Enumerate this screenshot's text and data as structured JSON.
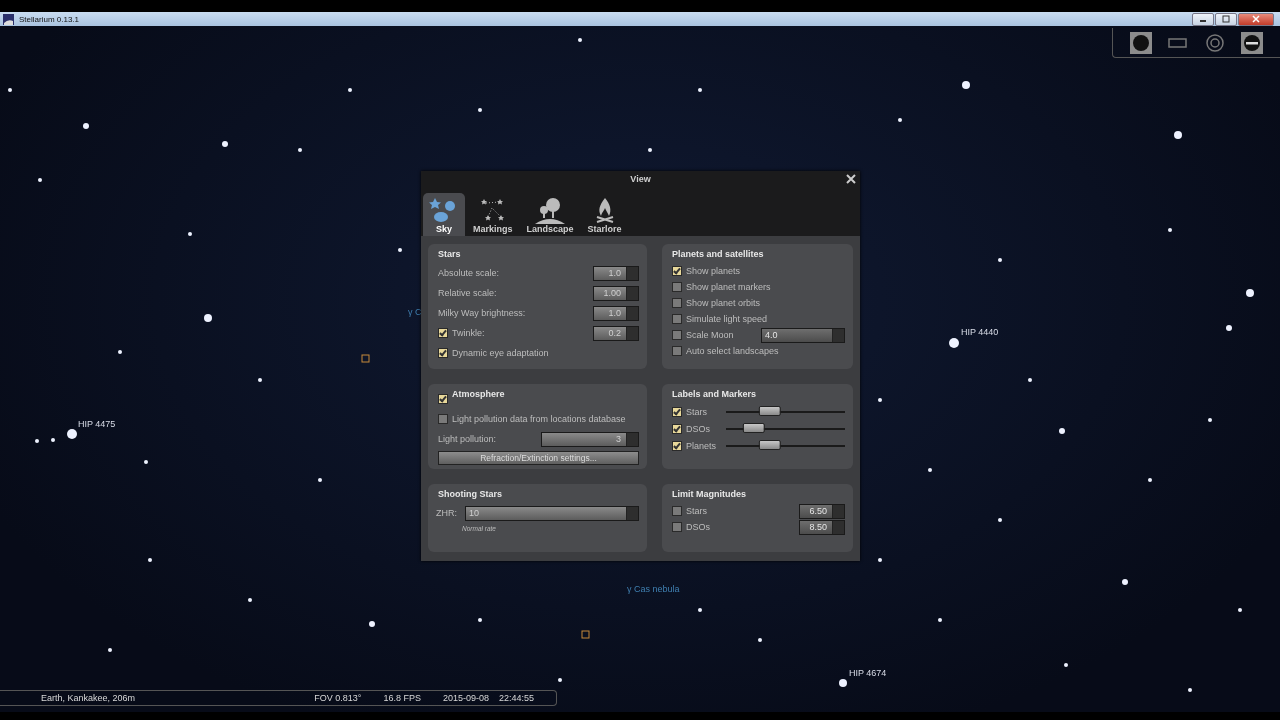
{
  "window": {
    "title": "Stellarium 0.13.1"
  },
  "sky_labels": [
    {
      "text": "HIP 4475"
    },
    {
      "text": "HIP 4440"
    },
    {
      "text": "HIP 4674"
    },
    {
      "text": "γ Cas nebula"
    },
    {
      "text": "γ C"
    }
  ],
  "dialog": {
    "title": "View",
    "tabs": [
      {
        "label": "Sky",
        "selected": true,
        "kind": "sky"
      },
      {
        "label": "Markings",
        "selected": false,
        "kind": "markings"
      },
      {
        "label": "Landscape",
        "selected": false,
        "kind": "landscape"
      },
      {
        "label": "Starlore",
        "selected": false,
        "kind": "starlore"
      }
    ],
    "stars": {
      "title": "Stars",
      "rows": [
        {
          "kind": "spin",
          "label": "Absolute scale:",
          "value": "1.0"
        },
        {
          "kind": "spin",
          "label": "Relative scale:",
          "value": "1.00"
        },
        {
          "kind": "spin",
          "label": "Milky Way brightness:",
          "value": "1.0"
        },
        {
          "kind": "checkspin",
          "label": "Twinkle:",
          "checked": true,
          "value": "0.2"
        },
        {
          "kind": "check",
          "label": "Dynamic eye adaptation",
          "checked": true
        }
      ]
    },
    "planets": {
      "title": "Planets and satellites",
      "rows": [
        {
          "kind": "check",
          "label": "Show planets",
          "checked": true
        },
        {
          "kind": "check",
          "label": "Show planet markers",
          "checked": false
        },
        {
          "kind": "check",
          "label": "Show planet orbits",
          "checked": false
        },
        {
          "kind": "check",
          "label": "Simulate light speed",
          "checked": false
        },
        {
          "kind": "checkspin",
          "label": "Scale Moon",
          "checked": false,
          "value": "4.0"
        },
        {
          "kind": "check",
          "label": "Auto select landscapes",
          "checked": false
        }
      ]
    },
    "atmosphere": {
      "title": "Atmosphere",
      "checked": true,
      "pollution_database": {
        "label": "Light pollution data from locations database",
        "checked": false
      },
      "light_pollution": {
        "label": "Light pollution:",
        "value": "3"
      },
      "button": "Refraction/Extinction settings..."
    },
    "labels": {
      "title": "Labels and Markers",
      "rows": [
        {
          "label": "Stars",
          "checked": true,
          "level": 0.3
        },
        {
          "label": "DSOs",
          "checked": true,
          "level": 0.17
        },
        {
          "label": "Planets",
          "checked": true,
          "level": 0.3
        }
      ]
    },
    "shooting": {
      "title": "Shooting Stars",
      "label": "ZHR:",
      "value": "10",
      "note": "Normal rate"
    },
    "limits": {
      "title": "Limit Magnitudes",
      "rows": [
        {
          "label": "Stars",
          "checked": false,
          "value": "6.50"
        },
        {
          "label": "DSOs",
          "checked": false,
          "value": "8.50"
        }
      ]
    }
  },
  "status_bar": {
    "location": "Earth, Kankakee, 206m",
    "fov": "FOV 0.813°",
    "fps": "16.8 FPS",
    "date": "2015-09-08",
    "time": "22:44:55"
  }
}
